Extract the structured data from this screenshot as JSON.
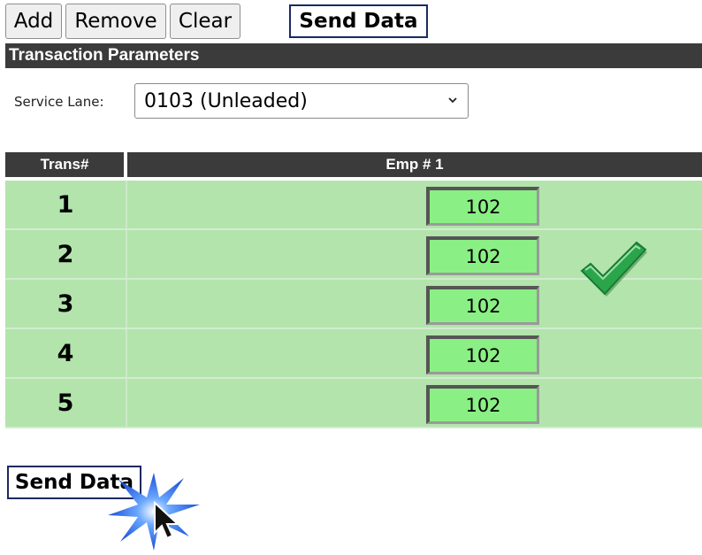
{
  "toolbar": {
    "add_label": "Add",
    "remove_label": "Remove",
    "clear_label": "Clear",
    "send_label": "Send Data"
  },
  "section": {
    "title": "Transaction Parameters"
  },
  "service_lane": {
    "label": "Service Lane:",
    "selected": "0103 (Unleaded)"
  },
  "table": {
    "headers": [
      "Trans#",
      "Emp # 1"
    ],
    "rows": [
      {
        "trans": "1",
        "emp": "102"
      },
      {
        "trans": "2",
        "emp": "102"
      },
      {
        "trans": "3",
        "emp": "102"
      },
      {
        "trans": "4",
        "emp": "102"
      },
      {
        "trans": "5",
        "emp": "102"
      }
    ]
  },
  "footer": {
    "send_label": "Send Data"
  },
  "icons": [
    "chevron-down-icon",
    "checkmark-icon",
    "click-burst-icon",
    "mouse-cursor-icon"
  ],
  "colors": {
    "row_bg": "#b2e4ac",
    "input_bg": "#8aef84",
    "header_bg": "#3b3b3b",
    "check": "#2aa54a"
  }
}
